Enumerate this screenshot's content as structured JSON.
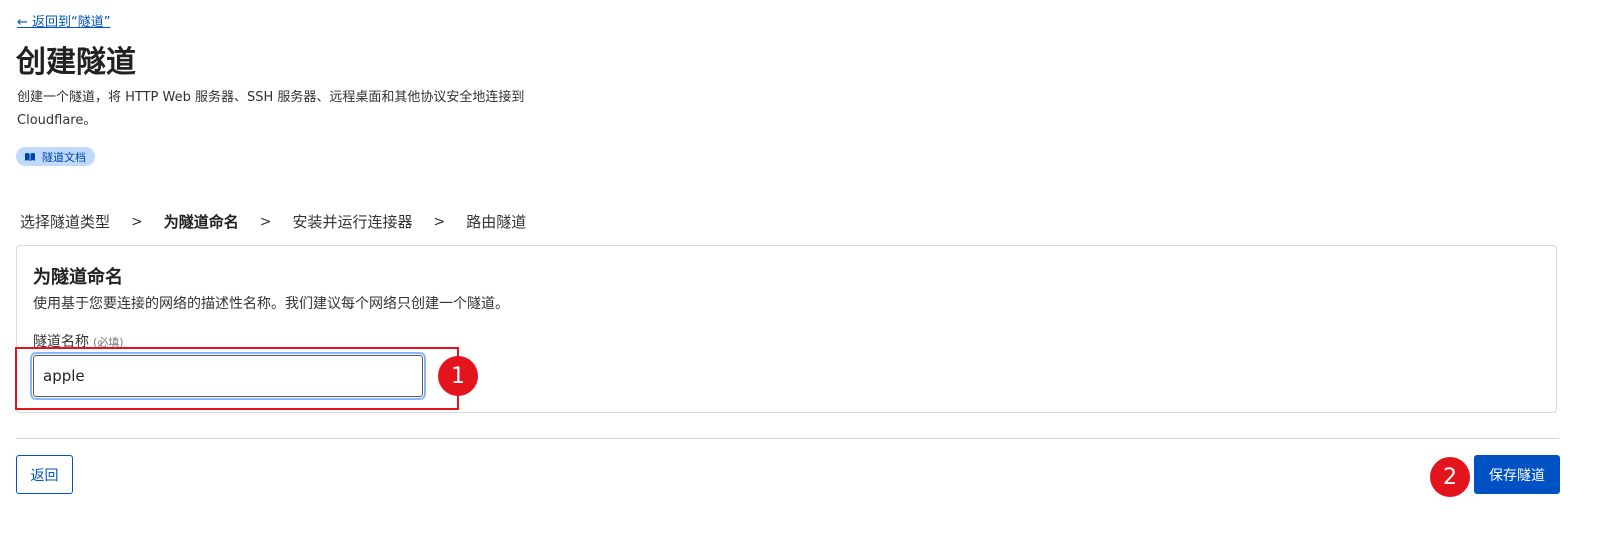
{
  "back_link": "← 返回到“隧道”",
  "page": {
    "title": "创建隧道",
    "description": "创建一个隧道，将 HTTP Web 服务器、SSH 服务器、远程桌面和其他协议安全地连接到 Cloudflare。",
    "doc_badge": "隧道文档"
  },
  "steps": [
    {
      "label": "选择隧道类型",
      "active": false
    },
    {
      "label": "为隧道命名",
      "active": true
    },
    {
      "label": "安装并运行连接器",
      "active": false
    },
    {
      "label": "路由隧道",
      "active": false
    }
  ],
  "step_separator": ">",
  "card": {
    "title": "为隧道命名",
    "description": "使用基于您要连接的网络的描述性名称。我们建议每个网络只创建一个隧道。",
    "field_label": "隧道名称",
    "field_required": "(必填)",
    "field_value": "apple"
  },
  "annotations": {
    "marker_1": "1",
    "marker_2": "2",
    "color": "#e3141c"
  },
  "buttons": {
    "back": "返回",
    "save": "保存隧道"
  },
  "colors": {
    "primary": "#0051c3",
    "badge_bg": "#bfd9ff"
  },
  "icons": {
    "doc_badge": "book-icon"
  }
}
